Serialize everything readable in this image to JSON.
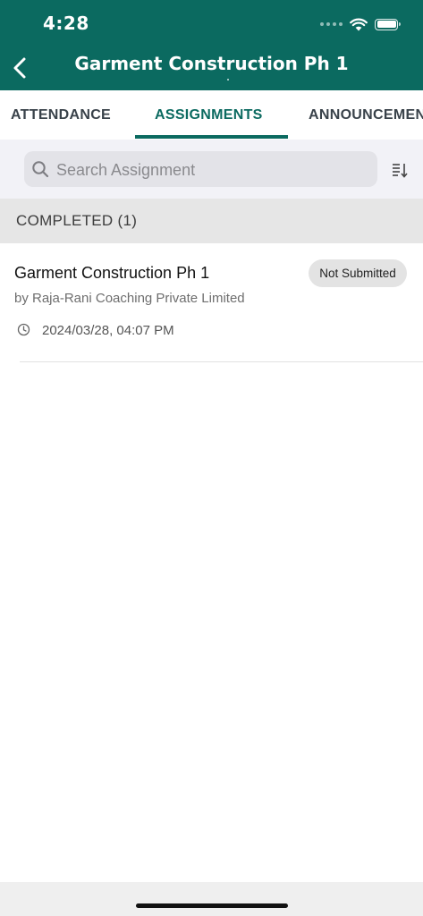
{
  "status_bar": {
    "time": "4:28"
  },
  "nav": {
    "title": "Garment Construction Ph 1"
  },
  "tabs": [
    {
      "label": "ATTENDANCE"
    },
    {
      "label": "ASSIGNMENTS"
    },
    {
      "label": "ANNOUNCEMENTS"
    }
  ],
  "active_tab": "ASSIGNMENTS",
  "search": {
    "placeholder": "Search Assignment",
    "value": ""
  },
  "section": {
    "label": "COMPLETED (1)"
  },
  "assignments": [
    {
      "title": "Garment Construction Ph 1",
      "by": "by Raja-Rani Coaching Private Limited",
      "status": "Not Submitted",
      "date": "2024/03/28, 04:07 PM"
    }
  ],
  "colors": {
    "brand": "#0b6a60",
    "section_bg": "#e6e6e6",
    "search_area_bg": "#f2f2f7"
  },
  "icons": [
    "back-chevron-icon",
    "wifi-icon",
    "battery-icon",
    "search-icon",
    "sort-icon",
    "clock-icon"
  ]
}
